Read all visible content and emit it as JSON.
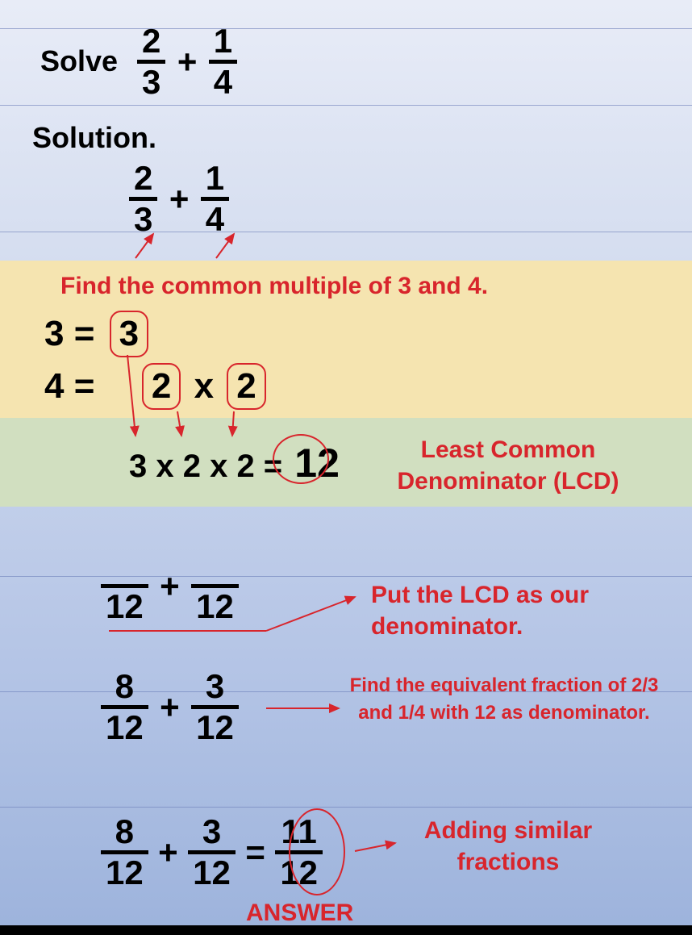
{
  "problem": {
    "solve_label": "Solve",
    "frac1": {
      "num": "2",
      "den": "3"
    },
    "plus": "+",
    "frac2": {
      "num": "1",
      "den": "4"
    }
  },
  "solution_label": "Solution.",
  "restate": {
    "frac1": {
      "num": "2",
      "den": "3"
    },
    "plus": "+",
    "frac2": {
      "num": "1",
      "den": "4"
    }
  },
  "find_common": {
    "heading": "Find the common multiple of 3 and 4.",
    "line1_lhs": "3 =",
    "line1_box": "3",
    "line2_lhs": "4 =",
    "line2_box1": "2",
    "line2_times": "x",
    "line2_box2": "2"
  },
  "lcd": {
    "expr_lhs": "3 x 2 x 2 =",
    "result": "12",
    "label": "Least Common Denominator (LCD)"
  },
  "denom_step": {
    "frac1_den": "12",
    "plus": "+",
    "frac2_den": "12",
    "note": "Put the LCD as our denominator."
  },
  "equiv_step": {
    "frac1": {
      "num": "8",
      "den": "12"
    },
    "plus": "+",
    "frac2": {
      "num": "3",
      "den": "12"
    },
    "note": "Find the equivalent fraction of 2/3 and 1/4 with 12 as denominator."
  },
  "sum_step": {
    "frac1": {
      "num": "8",
      "den": "12"
    },
    "plus": "+",
    "frac2": {
      "num": "3",
      "den": "12"
    },
    "equals": "=",
    "result": {
      "num": "11",
      "den": "12"
    },
    "note": "Adding similar fractions",
    "answer_label": "ANSWER"
  },
  "rules_y": [
    35,
    130,
    287,
    428,
    572,
    714,
    857,
    1000
  ]
}
